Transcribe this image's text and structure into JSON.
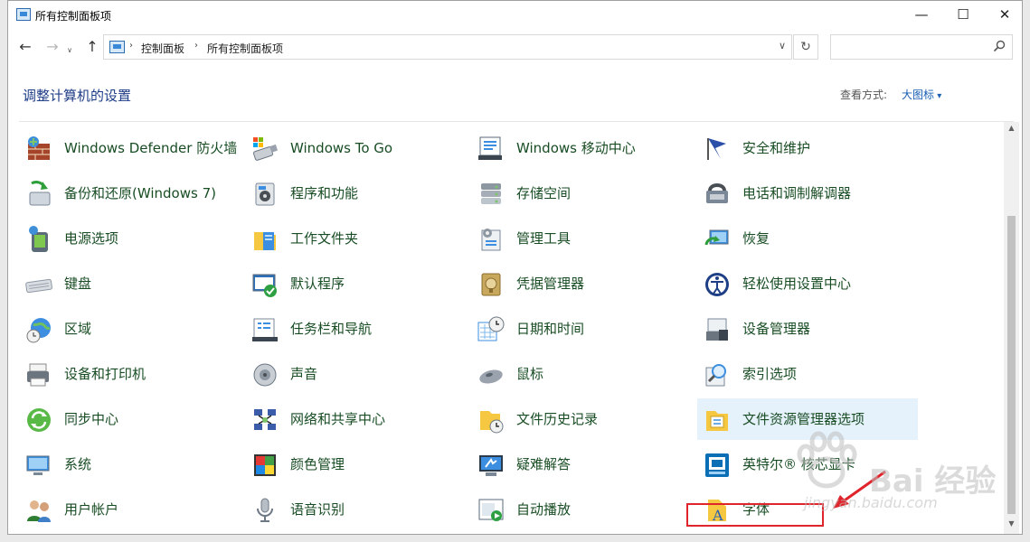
{
  "window": {
    "title": "所有控制面板项"
  },
  "titlebar": {
    "min": "—",
    "max": "☐",
    "close": "✕"
  },
  "nav": {
    "back": "←",
    "forward": "→",
    "recent": "∨",
    "up": "↑",
    "refresh": "↻",
    "dropdown": "∨"
  },
  "address": {
    "crumbs": [
      "控制面板",
      "所有控制面板项"
    ],
    "separator": "›"
  },
  "search": {
    "value": "",
    "placeholder": ""
  },
  "content": {
    "title": "调整计算机的设置",
    "view_label": "查看方式:",
    "view_value": "大图标"
  },
  "items": [
    [
      "Windows Defender 防火墙",
      "备份和还原(Windows 7)",
      "电源选项",
      "键盘",
      "区域",
      "设备和打印机",
      "同步中心",
      "系统",
      "用户帐户"
    ],
    [
      "Windows To Go",
      "程序和功能",
      "工作文件夹",
      "默认程序",
      "任务栏和导航",
      "声音",
      "网络和共享中心",
      "颜色管理",
      "语音识别"
    ],
    [
      "Windows 移动中心",
      "存储空间",
      "管理工具",
      "凭据管理器",
      "日期和时间",
      "鼠标",
      "文件历史记录",
      "疑难解答",
      "自动播放"
    ],
    [
      "安全和维护",
      "电话和调制解调器",
      "恢复",
      "轻松使用设置中心",
      "设备管理器",
      "索引选项",
      "文件资源管理器选项",
      "英特尔® 核芯显卡",
      "字体"
    ]
  ],
  "icons": [
    [
      "firewall-icon",
      "backup-icon",
      "power-icon",
      "keyboard-icon",
      "region-icon",
      "printer-icon",
      "sync-icon",
      "system-icon",
      "users-icon"
    ],
    [
      "usb-drive-icon",
      "programs-icon",
      "work-folder-icon",
      "default-programs-icon",
      "taskbar-icon",
      "sound-icon",
      "network-icon",
      "color-icon",
      "microphone-icon"
    ],
    [
      "mobility-icon",
      "storage-icon",
      "admin-tools-icon",
      "credential-icon",
      "clock-icon",
      "mouse-icon",
      "file-history-icon",
      "troubleshoot-icon",
      "autoplay-icon"
    ],
    [
      "flag-icon",
      "phone-modem-icon",
      "recovery-icon",
      "accessibility-icon",
      "device-manager-icon",
      "search-index-icon",
      "folder-options-icon",
      "intel-graphics-icon",
      "font-icon"
    ]
  ],
  "selected": {
    "col": 3,
    "row": 6
  },
  "watermark": {
    "text": "Bai 经验",
    "url": "jingyan.baidu.com"
  },
  "colors": {
    "label": "#184d24",
    "title": "#1e3d87",
    "link": "#1a5fb4",
    "highlight": "#e0242c",
    "selected_bg": "#e5f1fb"
  }
}
